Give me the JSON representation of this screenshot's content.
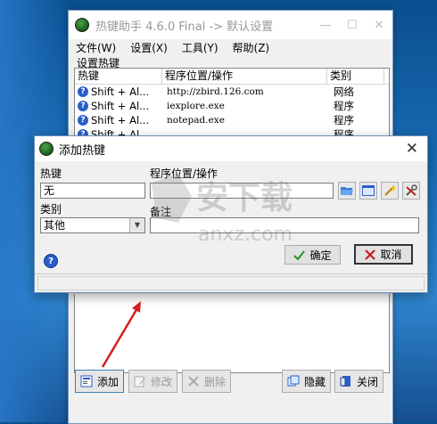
{
  "main_window": {
    "title": "热键助手 4.6.0 Final -> 默认设置",
    "menu": [
      "文件(W)",
      "设置(X)",
      "工具(Y)",
      "帮助(Z)"
    ],
    "group_label": "设置热键",
    "columns": [
      "热键",
      "程序位置/操作",
      "类别"
    ],
    "rows": [
      {
        "hotkey": "Shift + Al...",
        "program": "http://zbird.126.com",
        "category": "网络"
      },
      {
        "hotkey": "Shift + Al...",
        "program": "iexplore.exe",
        "category": "程序"
      },
      {
        "hotkey": "Shift + Al...",
        "program": "notepad.exe",
        "category": "程序"
      },
      {
        "hotkey": "Shift + Al...",
        "program": "",
        "category": "程序"
      }
    ],
    "buttons": {
      "add": "添加",
      "edit": "修改",
      "delete": "删除",
      "hide": "隐藏",
      "close": "关闭"
    }
  },
  "dialog": {
    "title": "添加热键",
    "hotkey_label": "热键",
    "hotkey_value": "无",
    "program_label": "程序位置/操作",
    "program_value": "",
    "category_label": "类别",
    "category_value": "其他",
    "note_label": "备注",
    "note_value": "",
    "ok_label": "确定",
    "cancel_label": "取消"
  },
  "colors": {
    "accent_blue": "#2a5fc9",
    "annotation_red": "#d42020"
  },
  "watermark": {
    "text": "安下载",
    "url": "anxz.com"
  }
}
